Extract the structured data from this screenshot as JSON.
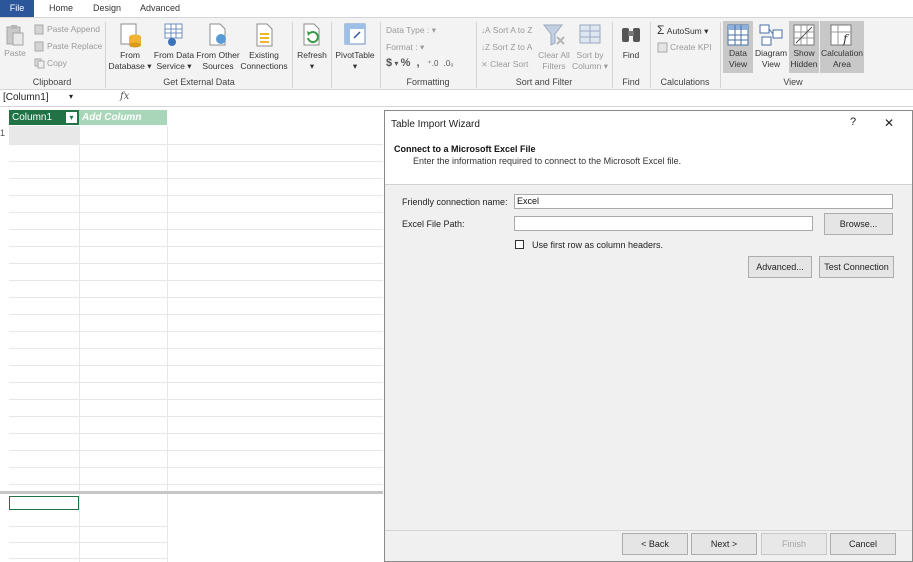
{
  "tabs": [
    {
      "label": "File"
    },
    {
      "label": "Home"
    },
    {
      "label": "Design"
    },
    {
      "label": "Advanced"
    }
  ],
  "ribbon": {
    "clipboard": {
      "paste": "Paste",
      "paste_append": "Paste Append",
      "paste_replace": "Paste Replace",
      "copy": "Copy",
      "label": "Clipboard"
    },
    "external": {
      "from_database_1": "From",
      "from_database_2": "Database",
      "from_data_service_1": "From Data",
      "from_data_service_2": "Service",
      "from_other_1": "From Other",
      "from_other_2": "Sources",
      "existing_1": "Existing",
      "existing_2": "Connections",
      "label": "Get External Data"
    },
    "refresh": "Refresh",
    "pivottable": "PivotTable",
    "formatting": {
      "data_type": "Data Type :",
      "format": "Format :",
      "label": "Formatting"
    },
    "sortfilter": {
      "sort_az": "Sort A to Z",
      "sort_za": "Sort Z to A",
      "clear_sort": "Clear Sort",
      "clear_all_1": "Clear All",
      "clear_all_2": "Filters",
      "sort_by_1": "Sort by",
      "sort_by_2": "Column",
      "label": "Sort and Filter"
    },
    "find": {
      "btn": "Find",
      "label": "Find"
    },
    "calculations": {
      "autosum": "AutoSum",
      "create_kpi": "Create KPI",
      "label": "Calculations"
    },
    "view": {
      "data_view_1": "Data",
      "data_view_2": "View",
      "diagram_view_1": "Diagram",
      "diagram_view_2": "View",
      "show_hidden_1": "Show",
      "show_hidden_2": "Hidden",
      "calc_area_1": "Calculation",
      "calc_area_2": "Area",
      "label": "View"
    }
  },
  "formula_bar": {
    "name_box": "[Column1]",
    "fx": "fx"
  },
  "grid": {
    "column1": "Column1",
    "add_column": "Add Column",
    "row1": "1"
  },
  "dialog": {
    "title": "Table Import Wizard",
    "help": "?",
    "close": "✕",
    "heading": "Connect to a Microsoft Excel File",
    "subheading": "Enter the information required to connect to the Microsoft Excel file.",
    "friendly_label": "Friendly connection name:",
    "friendly_value": "Excel",
    "path_label": "Excel File Path:",
    "path_value": "",
    "browse": "Browse...",
    "first_row": "Use first row as column headers.",
    "advanced": "Advanced...",
    "test_connection": "Test Connection",
    "back": "< Back",
    "next": "Next >",
    "finish": "Finish",
    "cancel": "Cancel"
  },
  "colors": {
    "accent": "#2b579a",
    "header_green": "#217346",
    "add_column_bg": "#a9d6b8"
  }
}
